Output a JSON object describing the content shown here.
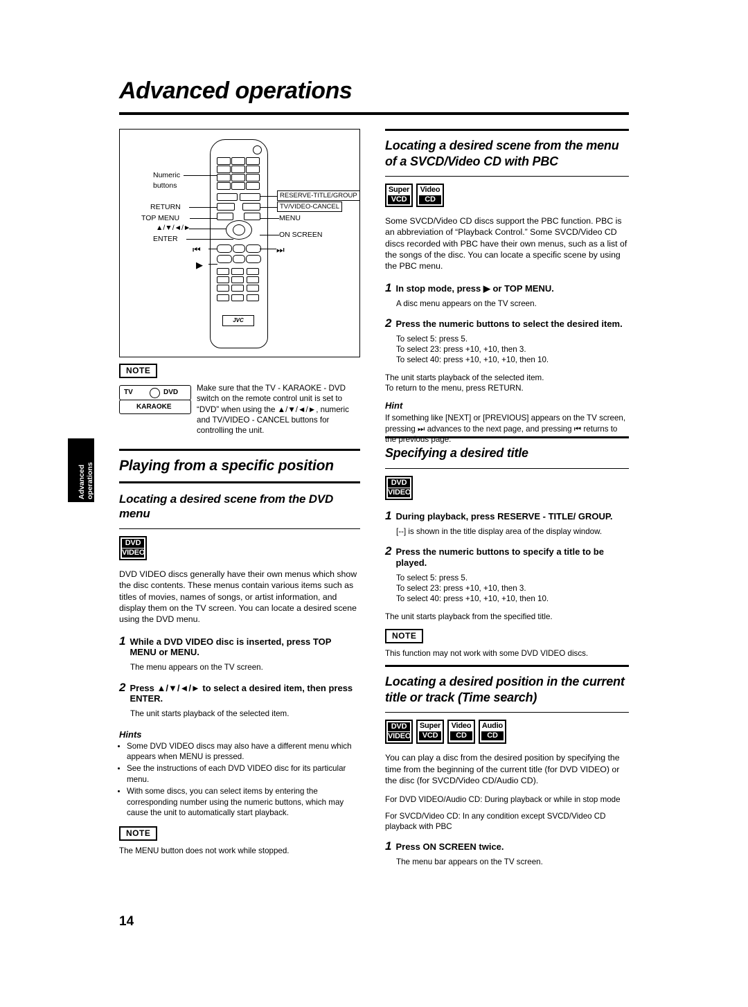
{
  "page": {
    "title": "Advanced operations",
    "number": "14",
    "side_tab": {
      "line1": "Advanced",
      "line2": "operations"
    }
  },
  "remote_diagram": {
    "labels": {
      "numeric_buttons_l1": "Numeric",
      "numeric_buttons_l2": "buttons",
      "return": "RETURN",
      "top_menu": "TOP MENU",
      "cursor": "▲/▼/◄/►",
      "enter": "ENTER",
      "reserve_title_group": "RESERVE-TITLE/GROUP",
      "tv_video_cancel": "TV/VIDEO-CANCEL",
      "menu": "MENU",
      "on_screen": "ON SCREEN",
      "prev": "⏮",
      "next": "⏭",
      "play": "▶",
      "brand": "JVC"
    }
  },
  "note_top": {
    "tag": "NOTE",
    "selector": {
      "tv": "TV",
      "dvd": "DVD",
      "karaoke": "KARAOKE"
    },
    "text": "Make sure that the TV - KARAOKE - DVD switch on the remote control unit is set to “DVD” when using the ▲/▼/◄/►, numeric and TV/VIDEO - CANCEL buttons for controlling the unit."
  },
  "left": {
    "section_title": "Playing from a specific position",
    "sub1": {
      "heading": "Locating a desired scene from the DVD menu",
      "badges": [
        {
          "lines": [
            "DVD",
            "VIDEO"
          ],
          "style": [
            "inv",
            "inv"
          ]
        }
      ],
      "intro": "DVD VIDEO discs generally have their own menus which show the disc contents. These menus contain various items such as titles of movies, names of songs, or artist information, and display them on the TV screen. You can locate a desired scene using the DVD menu.",
      "steps": [
        {
          "num": "1",
          "text": "While a DVD VIDEO disc is inserted, press TOP MENU or MENU.",
          "body": [
            "The menu appears on the TV screen."
          ]
        },
        {
          "num": "2",
          "text": "Press ▲/▼/◄/► to select a desired item, then press ENTER.",
          "body": [
            "The unit starts playback of the selected item."
          ]
        }
      ],
      "hints_heading": "Hints",
      "hints": [
        "Some DVD VIDEO discs may also have a different menu which appears when MENU is pressed.",
        "See the instructions of each DVD VIDEO disc for its particular menu.",
        "With some discs, you can select items by entering the corresponding number using the numeric buttons, which may cause the unit to automatically start playback."
      ],
      "note_tag": "NOTE",
      "note_text": "The MENU button does not work while stopped."
    }
  },
  "right": {
    "sub1": {
      "heading": "Locating a desired scene from the menu of a SVCD/Video CD with PBC",
      "badges": [
        {
          "lines": [
            "Super",
            "VCD"
          ],
          "style": [
            "plain",
            "inv"
          ]
        },
        {
          "lines": [
            "Video",
            "CD"
          ],
          "style": [
            "plain",
            "inv"
          ]
        }
      ],
      "intro": "Some SVCD/Video CD discs support the PBC function. PBC is an abbreviation of “Playback Control.” Some SVCD/Video CD discs recorded with PBC have their own menus, such as a list of the songs of the disc. You can locate a specific scene by using the PBC menu.",
      "steps": [
        {
          "num": "1",
          "text": "In stop mode, press ▶ or TOP MENU.",
          "body": [
            "A disc menu appears on the TV screen."
          ]
        },
        {
          "num": "2",
          "text": "Press the numeric buttons to select the desired item.",
          "body": [
            "To select 5: press 5.",
            "To select 23: press +10, +10, then 3.",
            "To select 40: press +10, +10, +10, then 10."
          ]
        }
      ],
      "after": [
        "The unit starts playback of the selected item.",
        "To return to the menu, press RETURN."
      ],
      "hint_heading": "Hint",
      "hint_text": "If something like [NEXT] or [PREVIOUS] appears on the TV screen, pressing ⏭ advances to the next page, and pressing ⏮ returns to the previous page."
    },
    "sub2": {
      "heading": "Specifying a desired title",
      "badges": [
        {
          "lines": [
            "DVD",
            "VIDEO"
          ],
          "style": [
            "inv",
            "inv"
          ]
        }
      ],
      "steps": [
        {
          "num": "1",
          "text": "During playback, press RESERVE - TITLE/ GROUP.",
          "body": [
            "[--] is shown in the title display area of the display window."
          ]
        },
        {
          "num": "2",
          "text": "Press the numeric buttons to specify a title to be played.",
          "body": [
            "To select 5: press 5.",
            "To select 23: press +10, +10, then 3.",
            "To select 40: press +10, +10, +10, then 10."
          ]
        }
      ],
      "after": [
        "The unit starts playback from the specified title."
      ],
      "note_tag": "NOTE",
      "note_text": "This function may not work with some DVD VIDEO discs."
    },
    "sub3": {
      "heading": "Locating a desired position in the current title or track (Time search)",
      "badges": [
        {
          "lines": [
            "DVD",
            "VIDEO"
          ],
          "style": [
            "inv",
            "inv"
          ]
        },
        {
          "lines": [
            "Super",
            "VCD"
          ],
          "style": [
            "plain",
            "inv"
          ]
        },
        {
          "lines": [
            "Video",
            "CD"
          ],
          "style": [
            "plain",
            "inv"
          ]
        },
        {
          "lines": [
            "Audio",
            "CD"
          ],
          "style": [
            "plain",
            "inv"
          ]
        }
      ],
      "intro": "You can play a disc from the desired position by specifying the time from the beginning of the current title (for DVD VIDEO) or the disc (for SVCD/Video CD/Audio CD).",
      "cond1": "For DVD VIDEO/Audio CD: During playback or while in stop mode",
      "cond2": "For SVCD/Video CD: In any condition except SVCD/Video CD playback with PBC",
      "steps": [
        {
          "num": "1",
          "text": "Press ON SCREEN twice.",
          "body": [
            "The menu bar appears on the TV screen."
          ]
        }
      ]
    }
  }
}
